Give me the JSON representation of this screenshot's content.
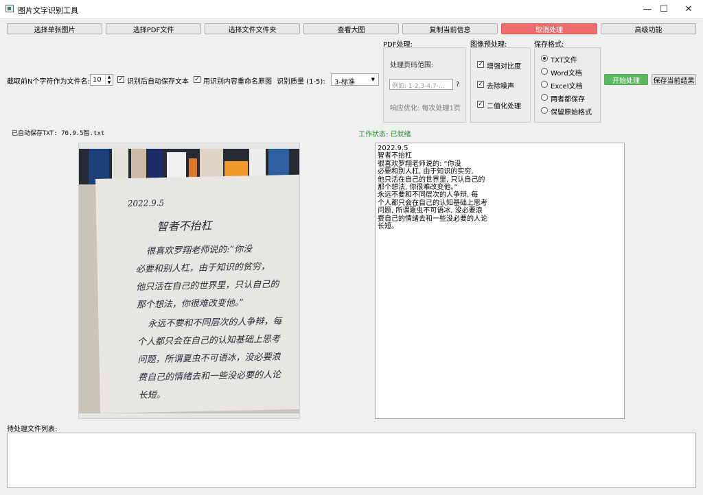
{
  "window": {
    "title": "图片文字识别工具",
    "minimize_glyph": "—",
    "maximize_glyph": "☐",
    "close_glyph": "✕"
  },
  "toolbar": {
    "select_image": "选择单张图片",
    "select_pdf": "选择PDF文件",
    "select_folder": "选择文件文件夹",
    "view_large": "查看大图",
    "copy_info": "复制当前信息",
    "cancel": "取消处理",
    "advanced": "高级功能"
  },
  "options": {
    "prefix_label": "截取前N个字符作为文件名:",
    "prefix_value": "10",
    "auto_save_label": "识别后自动保存文本",
    "rename_label": "用识别内容重命名原图",
    "quality_label": "识别质量 (1-5):",
    "quality_value": "3-标准"
  },
  "pdf": {
    "title": "PDF处理:",
    "range_label": "处理页码范围:",
    "range_placeholder": "例如: 1-2,3-4,7-…",
    "help_mark": "?",
    "optimize_label": "响应优化: 每次处理1页"
  },
  "preprocess": {
    "title": "图像预处理:",
    "items": [
      {
        "label": "增强对比度",
        "checked": true
      },
      {
        "label": "去除噪声",
        "checked": true
      },
      {
        "label": "二值化处理",
        "checked": true
      }
    ]
  },
  "format": {
    "title": "保存格式:",
    "options": [
      {
        "label": "TXT文件",
        "selected": true
      },
      {
        "label": "Word文档",
        "selected": false
      },
      {
        "label": "Excel文档",
        "selected": false
      },
      {
        "label": "两者都保存",
        "selected": false
      },
      {
        "label": "保留原始格式",
        "selected": false
      }
    ]
  },
  "actions": {
    "start": "开始处理",
    "save": "保存当前结果"
  },
  "status": {
    "autosave": "已自动保存TXT: 70.9.5智.txt",
    "work_state": "工作状态: 已就绪"
  },
  "handwriting": [
    "2022.9.5",
    "智者不抬杠",
    "很喜欢罗翔老师说的:“你没",
    "必要和别人杠，由于知识的贫穷，",
    "他只活在自己的世界里，只认自己的",
    "那个想法，你很难改变他。”",
    "永远不要和不同层次的人争辩，每",
    "个人都只会在自己的认知基础上思考",
    "问题，所谓夏虫不可语冰，没必要浪",
    "费自己的情绪去和一些没必要的人论",
    "长短。"
  ],
  "result_text": "2022.9.5\n智者不抬杠\n很喜欢罗翔老师说的: “你没\n必要和别人杠, 由于知识的实穷,\n他只活在自己的世界里, 只认自己的\n那个想法, 你很难改变他。”\n永远不要和不同层次的人争辩, 每\n个人都只会在自己的认知基础上思考\n问题, 所谓夏虫不可语冰, 没必要浪\n费自己的情绪去和一些没必要的人论\n长短。",
  "queue": {
    "label": "待处理文件列表:"
  },
  "colors": {
    "cancel_red": "#ee6b6b",
    "start_green": "#5cb85c",
    "status_green": "#2e8b2e"
  }
}
